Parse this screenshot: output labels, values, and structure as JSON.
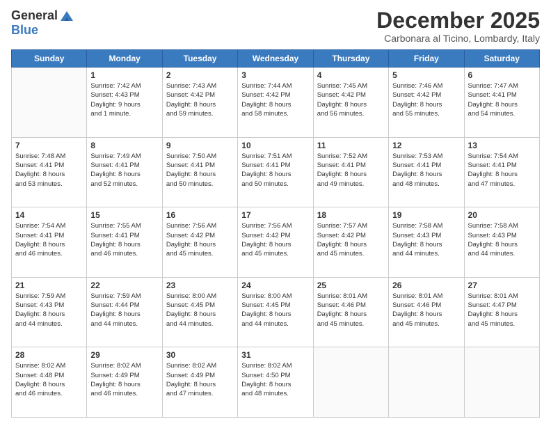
{
  "logo": {
    "general": "General",
    "blue": "Blue"
  },
  "title": "December 2025",
  "location": "Carbonara al Ticino, Lombardy, Italy",
  "days_header": [
    "Sunday",
    "Monday",
    "Tuesday",
    "Wednesday",
    "Thursday",
    "Friday",
    "Saturday"
  ],
  "weeks": [
    [
      {
        "day": "",
        "info": ""
      },
      {
        "day": "1",
        "info": "Sunrise: 7:42 AM\nSunset: 4:43 PM\nDaylight: 9 hours\nand 1 minute."
      },
      {
        "day": "2",
        "info": "Sunrise: 7:43 AM\nSunset: 4:42 PM\nDaylight: 8 hours\nand 59 minutes."
      },
      {
        "day": "3",
        "info": "Sunrise: 7:44 AM\nSunset: 4:42 PM\nDaylight: 8 hours\nand 58 minutes."
      },
      {
        "day": "4",
        "info": "Sunrise: 7:45 AM\nSunset: 4:42 PM\nDaylight: 8 hours\nand 56 minutes."
      },
      {
        "day": "5",
        "info": "Sunrise: 7:46 AM\nSunset: 4:42 PM\nDaylight: 8 hours\nand 55 minutes."
      },
      {
        "day": "6",
        "info": "Sunrise: 7:47 AM\nSunset: 4:41 PM\nDaylight: 8 hours\nand 54 minutes."
      }
    ],
    [
      {
        "day": "7",
        "info": "Sunrise: 7:48 AM\nSunset: 4:41 PM\nDaylight: 8 hours\nand 53 minutes."
      },
      {
        "day": "8",
        "info": "Sunrise: 7:49 AM\nSunset: 4:41 PM\nDaylight: 8 hours\nand 52 minutes."
      },
      {
        "day": "9",
        "info": "Sunrise: 7:50 AM\nSunset: 4:41 PM\nDaylight: 8 hours\nand 50 minutes."
      },
      {
        "day": "10",
        "info": "Sunrise: 7:51 AM\nSunset: 4:41 PM\nDaylight: 8 hours\nand 50 minutes."
      },
      {
        "day": "11",
        "info": "Sunrise: 7:52 AM\nSunset: 4:41 PM\nDaylight: 8 hours\nand 49 minutes."
      },
      {
        "day": "12",
        "info": "Sunrise: 7:53 AM\nSunset: 4:41 PM\nDaylight: 8 hours\nand 48 minutes."
      },
      {
        "day": "13",
        "info": "Sunrise: 7:54 AM\nSunset: 4:41 PM\nDaylight: 8 hours\nand 47 minutes."
      }
    ],
    [
      {
        "day": "14",
        "info": "Sunrise: 7:54 AM\nSunset: 4:41 PM\nDaylight: 8 hours\nand 46 minutes."
      },
      {
        "day": "15",
        "info": "Sunrise: 7:55 AM\nSunset: 4:41 PM\nDaylight: 8 hours\nand 46 minutes."
      },
      {
        "day": "16",
        "info": "Sunrise: 7:56 AM\nSunset: 4:42 PM\nDaylight: 8 hours\nand 45 minutes."
      },
      {
        "day": "17",
        "info": "Sunrise: 7:56 AM\nSunset: 4:42 PM\nDaylight: 8 hours\nand 45 minutes."
      },
      {
        "day": "18",
        "info": "Sunrise: 7:57 AM\nSunset: 4:42 PM\nDaylight: 8 hours\nand 45 minutes."
      },
      {
        "day": "19",
        "info": "Sunrise: 7:58 AM\nSunset: 4:43 PM\nDaylight: 8 hours\nand 44 minutes."
      },
      {
        "day": "20",
        "info": "Sunrise: 7:58 AM\nSunset: 4:43 PM\nDaylight: 8 hours\nand 44 minutes."
      }
    ],
    [
      {
        "day": "21",
        "info": "Sunrise: 7:59 AM\nSunset: 4:43 PM\nDaylight: 8 hours\nand 44 minutes."
      },
      {
        "day": "22",
        "info": "Sunrise: 7:59 AM\nSunset: 4:44 PM\nDaylight: 8 hours\nand 44 minutes."
      },
      {
        "day": "23",
        "info": "Sunrise: 8:00 AM\nSunset: 4:45 PM\nDaylight: 8 hours\nand 44 minutes."
      },
      {
        "day": "24",
        "info": "Sunrise: 8:00 AM\nSunset: 4:45 PM\nDaylight: 8 hours\nand 44 minutes."
      },
      {
        "day": "25",
        "info": "Sunrise: 8:01 AM\nSunset: 4:46 PM\nDaylight: 8 hours\nand 45 minutes."
      },
      {
        "day": "26",
        "info": "Sunrise: 8:01 AM\nSunset: 4:46 PM\nDaylight: 8 hours\nand 45 minutes."
      },
      {
        "day": "27",
        "info": "Sunrise: 8:01 AM\nSunset: 4:47 PM\nDaylight: 8 hours\nand 45 minutes."
      }
    ],
    [
      {
        "day": "28",
        "info": "Sunrise: 8:02 AM\nSunset: 4:48 PM\nDaylight: 8 hours\nand 46 minutes."
      },
      {
        "day": "29",
        "info": "Sunrise: 8:02 AM\nSunset: 4:49 PM\nDaylight: 8 hours\nand 46 minutes."
      },
      {
        "day": "30",
        "info": "Sunrise: 8:02 AM\nSunset: 4:49 PM\nDaylight: 8 hours\nand 47 minutes."
      },
      {
        "day": "31",
        "info": "Sunrise: 8:02 AM\nSunset: 4:50 PM\nDaylight: 8 hours\nand 48 minutes."
      },
      {
        "day": "",
        "info": ""
      },
      {
        "day": "",
        "info": ""
      },
      {
        "day": "",
        "info": ""
      }
    ]
  ]
}
